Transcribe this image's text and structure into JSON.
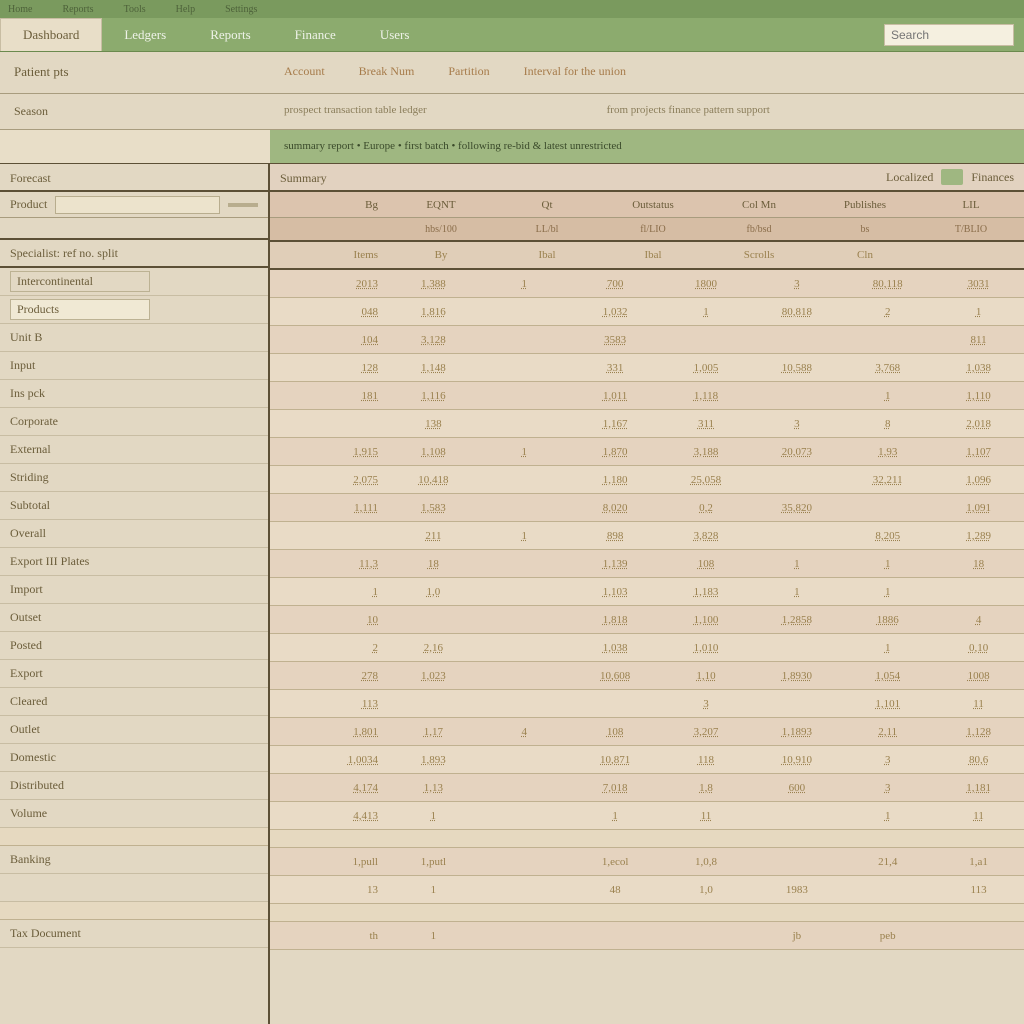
{
  "topbar": {
    "items": [
      "Home",
      "Reports",
      "Tools",
      "Help",
      "Settings"
    ]
  },
  "nav": {
    "tabs": [
      {
        "label": "Dashboard",
        "active": true
      },
      {
        "label": "Ledgers",
        "active": false
      },
      {
        "label": "Reports",
        "active": false
      },
      {
        "label": "Finance",
        "active": false
      },
      {
        "label": "Users",
        "active": false
      }
    ],
    "search_placeholder": "Search"
  },
  "subheader": {
    "left": "Patient pts",
    "links": [
      "Account",
      "Break Num",
      "Partition",
      "Interval for the union"
    ]
  },
  "filter": {
    "label": "Season",
    "mid_left": "prospect transaction table ledger",
    "mid_right": "from projects finance pattern support"
  },
  "banner": "summary report • Europe • first batch • following re-bid & latest unrestricted",
  "sidebar": {
    "header": "Forecast",
    "filter_label": "Product",
    "section": "Specialist: ref no. split",
    "items": [
      {
        "label": "Intercontinental",
        "boxed": true,
        "sel": false
      },
      {
        "label": "Products",
        "boxed": true,
        "sel": true
      },
      {
        "label": "Unit B",
        "boxed": false,
        "sel": false
      },
      {
        "label": "Input",
        "boxed": false,
        "sel": false
      },
      {
        "label": "Ins pck",
        "boxed": false,
        "sel": false
      },
      {
        "label": "Corporate",
        "boxed": false,
        "sel": false
      },
      {
        "label": "External",
        "boxed": false,
        "sel": false
      },
      {
        "label": "Striding",
        "boxed": false,
        "sel": false
      },
      {
        "label": "Subtotal",
        "boxed": false,
        "sel": false
      },
      {
        "label": "Overall",
        "boxed": false,
        "sel": false
      },
      {
        "label": "Export III Plates",
        "boxed": false,
        "sel": false
      },
      {
        "label": "Import",
        "boxed": false,
        "sel": false
      },
      {
        "label": "Outset",
        "boxed": false,
        "sel": false
      },
      {
        "label": "Posted",
        "boxed": false,
        "sel": false
      },
      {
        "label": "Export",
        "boxed": false,
        "sel": false
      },
      {
        "label": "Cleared",
        "boxed": false,
        "sel": false
      },
      {
        "label": "Outlet",
        "boxed": false,
        "sel": false
      },
      {
        "label": "Domestic",
        "boxed": false,
        "sel": false
      },
      {
        "label": "Distributed",
        "boxed": false,
        "sel": false
      },
      {
        "label": "Volume",
        "boxed": false,
        "sel": false
      }
    ],
    "group2": [
      "Banking",
      ""
    ],
    "group3": [
      "Tax Document"
    ]
  },
  "table": {
    "header_title": "Summary",
    "header_right_a": "Localized",
    "header_right_b": "Finances",
    "cols_main": [
      "Bg",
      "EQNT",
      "Qt",
      "Outstatus",
      "Col Mn",
      "Publishes",
      "LIL"
    ],
    "cols_sub": [
      "hbs/100",
      "LL/bl",
      "fl/LIO",
      "fb/bsd",
      "bs",
      "T/BLIO"
    ],
    "rows_hdr": [
      "Items",
      "By",
      "Ibal",
      "Ibal",
      "Scrolls",
      "Cln"
    ],
    "rows": [
      [
        "2013",
        "1,388",
        "1",
        "700",
        "1800",
        "3",
        "80,118",
        "3031"
      ],
      [
        "048",
        "1,816",
        "",
        "1,032",
        "1",
        "80,818",
        "2",
        "1"
      ],
      [
        "104",
        "3,128",
        "",
        "3583",
        "",
        "",
        "",
        "811"
      ],
      [
        "128",
        "1,148",
        "",
        "331",
        "1,005",
        "10,588",
        "3,768",
        "1,038"
      ],
      [
        "181",
        "1,116",
        "",
        "1,011",
        "1,118",
        "",
        "1",
        "1,110"
      ],
      [
        "",
        "138",
        "",
        "1,167",
        "311",
        "3",
        "8",
        "2,018"
      ],
      [
        "1,915",
        "1,108",
        "1",
        "1,870",
        "3,188",
        "20,073",
        "1,93",
        "1,107"
      ],
      [
        "2,075",
        "10,418",
        "",
        "1,180",
        "25,058",
        "",
        "32,211",
        "1,096"
      ],
      [
        "1,111",
        "1,583",
        "",
        "8,020",
        "0,2",
        "35,820",
        "",
        "1,091"
      ],
      [
        "",
        "211",
        "1",
        "898",
        "3,828",
        "",
        "8,205",
        "1,289"
      ],
      [
        "11,3",
        "18",
        "",
        "1,139",
        "108",
        "1",
        "1",
        "18"
      ],
      [
        "1",
        "1,0",
        "",
        "1,103",
        "1,183",
        "1",
        "1",
        ""
      ],
      [
        "10",
        "",
        "",
        "1,818",
        "1,100",
        "1,2858",
        "1886",
        "4"
      ],
      [
        "2",
        "2,16",
        "",
        "1,038",
        "1,010",
        "",
        "1",
        "0,10"
      ],
      [
        "278",
        "1,023",
        "",
        "10,608",
        "1,10",
        "1,8930",
        "1,054",
        "1008"
      ],
      [
        "113",
        "",
        "",
        "",
        "3",
        "",
        "1,101",
        "11"
      ],
      [
        "1,801",
        "1,17",
        "4",
        "108",
        "3,207",
        "1,1893",
        "2,11",
        "1,128"
      ],
      [
        "1,0034",
        "1,893",
        "",
        "10,871",
        "118",
        "10,910",
        "3",
        "80,6"
      ],
      [
        "4,174",
        "1,13",
        "",
        "7,018",
        "1,8",
        "600",
        "3",
        "1,181"
      ],
      [
        "4,413",
        "1",
        "",
        "1",
        "11",
        "",
        "1",
        "11"
      ]
    ],
    "gap_rows": [
      [
        "1,pull",
        "1,putl",
        "",
        "1,ecol",
        "1,0,8",
        "",
        "21,4",
        "1,a1"
      ],
      [
        "13",
        "1",
        "",
        "48",
        "1,0",
        "1983",
        "",
        "113"
      ]
    ],
    "final": [
      "th",
      "1",
      "",
      "",
      "",
      "jb",
      "peb",
      ""
    ]
  }
}
